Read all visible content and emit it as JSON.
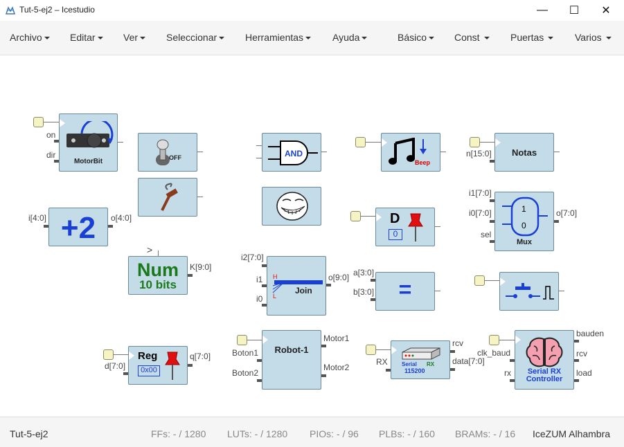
{
  "window": {
    "title": "Tut-5-ej2 – Icestudio",
    "controls": [
      "—",
      "☐",
      "✕"
    ]
  },
  "menu": {
    "left": [
      "Archivo",
      "Editar",
      "Ver",
      "Seleccionar",
      "Herramientas",
      "Ayuda"
    ],
    "right": [
      "Básico",
      "Const",
      "Puertas",
      "Varios"
    ]
  },
  "blocks": {
    "motorbit": {
      "label": "MotorBit",
      "ports_in": [
        "on",
        "dir"
      ]
    },
    "switch": {
      "label": "OFF"
    },
    "and_gate": {
      "label": "AND"
    },
    "beep": {
      "label": "Beep"
    },
    "notas": {
      "label": "Notas",
      "port_in": "n[15:0]"
    },
    "plus2": {
      "label": "+2",
      "port_in": "i[4:0]",
      "port_out": "o[4:0]"
    },
    "num": {
      "label": "Num",
      "sublabel": "10 bits",
      "port_out": "K[9:0]",
      "param_mark": ">"
    },
    "dflip": {
      "label": "D",
      "value": "0"
    },
    "mux": {
      "label": "Mux",
      "ports_in": [
        "i1[7:0]",
        "i0[7:0]",
        "sel"
      ],
      "port_out": "o[7:0]",
      "in1": "1",
      "in0": "0"
    },
    "join": {
      "label": "Join",
      "ports_in": [
        "i2[7:0]",
        "i1",
        "i0"
      ],
      "port_out": "o[9:0]",
      "h": "H",
      "l": "L"
    },
    "equal": {
      "label": "=",
      "ports_in": [
        "a[3:0]",
        "b[3:0]"
      ]
    },
    "reg": {
      "label": "Reg",
      "value": "0x00",
      "port_in": "d[7:0]",
      "port_out": "q[7:0]"
    },
    "robot": {
      "label": "Robot-1",
      "ports_in": [
        "Boton1",
        "Boton2"
      ],
      "ports_out": [
        "Motor1",
        "Motor2"
      ]
    },
    "serial": {
      "label": "Serial",
      "sublabel_rx": "RX",
      "baud": "115200",
      "port_in": "RX",
      "ports_out": [
        "rcv",
        "data[7:0]"
      ]
    },
    "serial_ctrl": {
      "label": "Serial RX",
      "sublabel": "Controller",
      "ports_in": [
        "clk_baud",
        "rx"
      ],
      "ports_out": [
        "bauden",
        "rcv",
        "load"
      ]
    }
  },
  "status": {
    "project": "Tut-5-ej2",
    "ffs": "FFs:  - / 1280",
    "luts": "LUTs:  - / 1280",
    "pios": "PIOs:  - / 96",
    "plbs": "PLBs:  - / 160",
    "brams": "BRAMs:  - / 16",
    "board": "IceZUM Alhambra"
  }
}
